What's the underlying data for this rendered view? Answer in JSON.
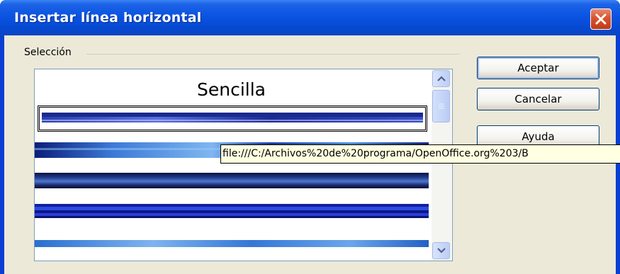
{
  "window": {
    "title": "Insertar línea horizontal"
  },
  "selection": {
    "label": "Selección",
    "heading": "Sencilla",
    "items": [
      "line-1",
      "line-2",
      "line-3",
      "line-4",
      "line-5"
    ]
  },
  "buttons": {
    "ok": "Aceptar",
    "cancel": "Cancelar",
    "help": "Ayuda"
  },
  "tooltip": {
    "text": "file:///C:/Archivos%20de%20programa/OpenOffice.org%203/B"
  },
  "colors": {
    "titlebar": "#0a54e2",
    "dialog_bg": "#ece9d8",
    "accent_blue": "#1a2fa0",
    "tooltip_bg": "#ffffe1"
  },
  "icons": {
    "close": "close-x-icon",
    "scroll_up": "chevron-up-icon",
    "scroll_down": "chevron-down-icon"
  }
}
